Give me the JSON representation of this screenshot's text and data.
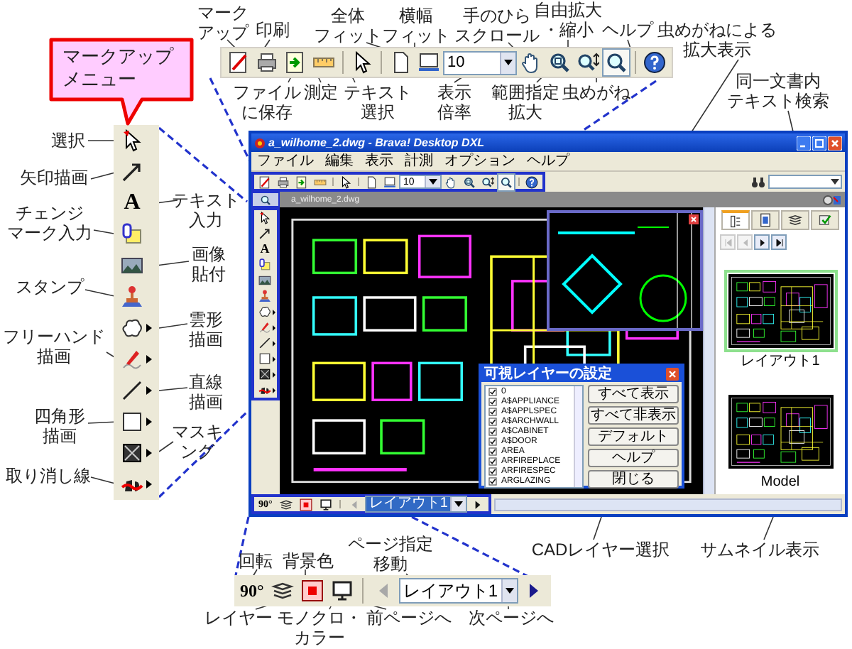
{
  "callout": {
    "text": "マークアップメニュー"
  },
  "annotations": [
    {
      "text": "マークアップ"
    },
    {
      "text": "印刷"
    },
    {
      "text": "全体フィット"
    },
    {
      "text": "横幅フィット"
    },
    {
      "text": "手のひらスクロール"
    },
    {
      "text": "自由拡大・縮小"
    },
    {
      "text": "ヘルプ"
    },
    {
      "text": "虫めがねによる拡大表示"
    },
    {
      "text": "ファイルに保存"
    },
    {
      "text": "測定"
    },
    {
      "text": "テキスト選択"
    },
    {
      "text": "表示倍率"
    },
    {
      "text": "範囲指定拡大"
    },
    {
      "text": "虫めがね"
    },
    {
      "text": "同一文書内テキスト検索"
    },
    {
      "text": "選択"
    },
    {
      "text": "矢印描画"
    },
    {
      "text": "テキスト入力"
    },
    {
      "text": "チェンジマーク入力"
    },
    {
      "text": "画像貼付"
    },
    {
      "text": "スタンプ"
    },
    {
      "text": "雲形描画"
    },
    {
      "text": "フリーハンド描画"
    },
    {
      "text": "直線描画"
    },
    {
      "text": "四角形描画"
    },
    {
      "text": "マスキング"
    },
    {
      "text": "取り消し線"
    },
    {
      "text": "回転"
    },
    {
      "text": "背景色"
    },
    {
      "text": "ページ指定移動"
    },
    {
      "text": "CADレイヤー選択"
    },
    {
      "text": "サムネイル表示"
    },
    {
      "text": "レイヤー"
    },
    {
      "text": "モノクロ・カラー"
    },
    {
      "text": "前ページへ"
    },
    {
      "text": "次ページへ"
    }
  ],
  "top_toolbar": {
    "items": [
      {
        "kind": "markup",
        "pressed": false
      },
      {
        "kind": "print",
        "pressed": false
      },
      {
        "kind": "save",
        "pressed": false
      },
      {
        "kind": "measure",
        "pressed": false
      },
      {
        "kind": "separator"
      },
      {
        "kind": "select",
        "pressed": false
      },
      {
        "kind": "separator"
      },
      {
        "kind": "fit-page",
        "pressed": false
      },
      {
        "kind": "fit-width",
        "pressed": false
      },
      {
        "kind": "combo",
        "value": "10"
      },
      {
        "kind": "hand",
        "pressed": false
      },
      {
        "kind": "zoom-area",
        "pressed": false
      },
      {
        "kind": "zoom-free",
        "pressed": false
      },
      {
        "kind": "magnifier",
        "pressed": true
      },
      {
        "kind": "separator"
      },
      {
        "kind": "help",
        "pressed": false
      }
    ]
  },
  "left_toolbar": {
    "tools": [
      {
        "kind": "pointer",
        "submenu": false
      },
      {
        "kind": "arrow",
        "submenu": false
      },
      {
        "kind": "text",
        "glyph": "A",
        "submenu": false
      },
      {
        "kind": "change-mark",
        "submenu": false
      },
      {
        "kind": "image",
        "submenu": false
      },
      {
        "kind": "stamp",
        "submenu": false
      },
      {
        "kind": "cloud",
        "submenu": true
      },
      {
        "kind": "freehand",
        "submenu": true
      },
      {
        "kind": "line",
        "submenu": true
      },
      {
        "kind": "rectangle",
        "submenu": true
      },
      {
        "kind": "masking",
        "submenu": true
      },
      {
        "kind": "strikethrough",
        "submenu": true
      }
    ]
  },
  "bottom_toolbar": {
    "items": [
      {
        "kind": "rotate",
        "glyph": "90°"
      },
      {
        "kind": "layers"
      },
      {
        "kind": "background"
      },
      {
        "kind": "mono"
      },
      {
        "kind": "separator"
      },
      {
        "kind": "prev",
        "disabled": true
      },
      {
        "kind": "combo",
        "value": "レイアウト1",
        "highlighted": false
      },
      {
        "kind": "next",
        "disabled": false
      }
    ]
  },
  "window": {
    "title": "a_wilhome_2.dwg - Brava! Desktop DXL",
    "menus": [
      "ファイル",
      "編集",
      "表示",
      "計測",
      "オプション",
      "ヘルプ"
    ],
    "toolbar": {
      "items": [
        {
          "kind": "markup",
          "pressed": false
        },
        {
          "kind": "print",
          "pressed": false
        },
        {
          "kind": "save",
          "pressed": false
        },
        {
          "kind": "measure",
          "pressed": false
        },
        {
          "kind": "separator"
        },
        {
          "kind": "select",
          "pressed": false
        },
        {
          "kind": "separator"
        },
        {
          "kind": "fit-page",
          "pressed": false
        },
        {
          "kind": "fit-width",
          "pressed": false
        },
        {
          "kind": "combo",
          "value": "10"
        },
        {
          "kind": "hand",
          "pressed": false
        },
        {
          "kind": "zoom-area",
          "pressed": false
        },
        {
          "kind": "zoom-free",
          "pressed": false
        },
        {
          "kind": "magnifier",
          "pressed": true
        },
        {
          "kind": "separator"
        },
        {
          "kind": "help",
          "pressed": false
        }
      ]
    },
    "tab": "a_wilhome_2.dwg",
    "left_tools": [
      {
        "kind": "pointer",
        "submenu": false
      },
      {
        "kind": "arrow",
        "submenu": false
      },
      {
        "kind": "text",
        "glyph": "A",
        "submenu": false
      },
      {
        "kind": "change-mark",
        "submenu": false
      },
      {
        "kind": "image",
        "submenu": false
      },
      {
        "kind": "stamp",
        "submenu": false
      },
      {
        "kind": "cloud",
        "submenu": true
      },
      {
        "kind": "freehand",
        "submenu": true
      },
      {
        "kind": "line",
        "submenu": true
      },
      {
        "kind": "rectangle",
        "submenu": true
      },
      {
        "kind": "masking",
        "submenu": true
      },
      {
        "kind": "strikethrough",
        "submenu": true
      }
    ],
    "bottom_bar": {
      "items": [
        {
          "kind": "rotate",
          "glyph": "90°"
        },
        {
          "kind": "layers"
        },
        {
          "kind": "background"
        },
        {
          "kind": "mono"
        },
        {
          "kind": "separator"
        },
        {
          "kind": "prev",
          "disabled": true
        },
        {
          "kind": "combo",
          "value": "レイアウト1",
          "highlighted": true
        },
        {
          "kind": "next",
          "disabled": false
        }
      ]
    },
    "right_panel": {
      "tabs": [
        {
          "kind": "pages",
          "selected": true
        },
        {
          "kind": "document",
          "selected": false
        },
        {
          "kind": "layers",
          "selected": false
        },
        {
          "kind": "checklist",
          "selected": false
        }
      ],
      "nav": [
        {
          "kind": "first",
          "disabled": true
        },
        {
          "kind": "prev",
          "disabled": true
        },
        {
          "kind": "next",
          "disabled": false
        },
        {
          "kind": "last",
          "disabled": false
        }
      ],
      "thumbnails": [
        {
          "label": "レイアウト1",
          "selected": true
        },
        {
          "label": "Model",
          "selected": false
        }
      ]
    },
    "layer_dialog": {
      "title": "可視レイヤーの設定",
      "layers": [
        {
          "name": "0",
          "checked": true
        },
        {
          "name": "A$APPLIANCE",
          "checked": true
        },
        {
          "name": "A$APPLSPEC",
          "checked": true
        },
        {
          "name": "A$ARCHWALL",
          "checked": true
        },
        {
          "name": "A$CABINET",
          "checked": true
        },
        {
          "name": "A$DOOR",
          "checked": true
        },
        {
          "name": "AREA",
          "checked": true
        },
        {
          "name": "ARFIREPLACE",
          "checked": true
        },
        {
          "name": "ARFIRESPEC",
          "checked": true
        },
        {
          "name": "ARGLAZING",
          "checked": true
        }
      ],
      "buttons": [
        "すべて表示",
        "すべて非表示",
        "デフォルト",
        "ヘルプ"
      ],
      "close_button": "閉じる"
    }
  }
}
